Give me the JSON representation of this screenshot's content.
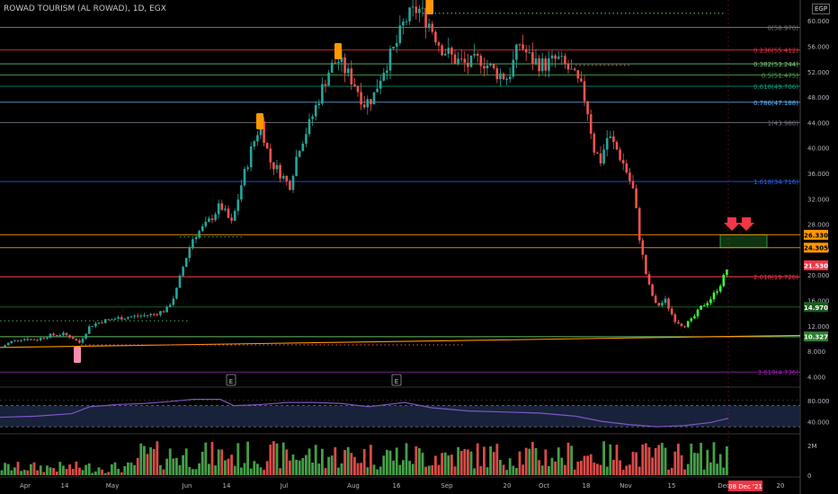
{
  "header": {
    "title": "ROWAD TOURISM (AL ROWAD), 1D, EGX",
    "currency": "EGP"
  },
  "chart_data": {
    "type": "candlestick",
    "title": "ROWAD TOURISM (AL ROWAD), 1D, EGX",
    "y_axis": {
      "ticks": [
        "60.000",
        "56.000",
        "52.000",
        "48.000",
        "44.000",
        "40.000",
        "36.000",
        "32.000",
        "28.000",
        "24.000",
        "20.000",
        "16.000",
        "12.000",
        "8.000",
        "4.000"
      ],
      "tick_values": [
        60,
        56,
        52,
        48,
        44,
        40,
        36,
        32,
        28,
        24,
        20,
        16,
        12,
        8,
        4
      ],
      "range": [
        2.5,
        63
      ]
    },
    "x_axis": {
      "labels": [
        "Apr",
        "14",
        "May",
        "Jun",
        "14",
        "Jul",
        "Aug",
        "16",
        "Sep",
        "20",
        "Oct",
        "18",
        "Nov",
        "15",
        "Dec",
        "20"
      ],
      "date_label": "08 Dec '21"
    },
    "close_path": [
      [
        0,
        8.5
      ],
      [
        12,
        9.5
      ],
      [
        25,
        10.0
      ],
      [
        40,
        9.8
      ],
      [
        55,
        10.5
      ],
      [
        70,
        10.7
      ],
      [
        80,
        10.2
      ],
      [
        88,
        9.3
      ],
      [
        100,
        12.0
      ],
      [
        115,
        12.8
      ],
      [
        130,
        13.2
      ],
      [
        150,
        13.5
      ],
      [
        170,
        13.8
      ],
      [
        185,
        14.5
      ],
      [
        195,
        17.0
      ],
      [
        205,
        22.0
      ],
      [
        215,
        26.0
      ],
      [
        230,
        28.0
      ],
      [
        245,
        31.0
      ],
      [
        258,
        28.0
      ],
      [
        268,
        34.0
      ],
      [
        280,
        40.0
      ],
      [
        290,
        44.0
      ],
      [
        300,
        38.0
      ],
      [
        312,
        36.0
      ],
      [
        322,
        34.0
      ],
      [
        332,
        40.0
      ],
      [
        345,
        44.0
      ],
      [
        355,
        48.0
      ],
      [
        365,
        52.0
      ],
      [
        375,
        54.0
      ],
      [
        385,
        52.0
      ],
      [
        395,
        50.0
      ],
      [
        405,
        47.0
      ],
      [
        415,
        48.0
      ],
      [
        425,
        52.0
      ],
      [
        440,
        56.0
      ],
      [
        450,
        60.0
      ],
      [
        465,
        62.0
      ],
      [
        478,
        59.5
      ],
      [
        490,
        56.0
      ],
      [
        505,
        54.0
      ],
      [
        520,
        53.0
      ],
      [
        535,
        54.0
      ],
      [
        550,
        52.0
      ],
      [
        565,
        51.0
      ],
      [
        578,
        56.5
      ],
      [
        590,
        54.0
      ],
      [
        605,
        53.0
      ],
      [
        620,
        54.0
      ],
      [
        635,
        52.0
      ],
      [
        648,
        49.0
      ],
      [
        655,
        45.0
      ],
      [
        660,
        40.0
      ],
      [
        668,
        38.0
      ],
      [
        676,
        42.0
      ],
      [
        685,
        40.0
      ],
      [
        695,
        37.0
      ],
      [
        705,
        33.0
      ],
      [
        712,
        25.0
      ],
      [
        720,
        19.0
      ],
      [
        730,
        15.0
      ],
      [
        740,
        16.0
      ],
      [
        750,
        13.0
      ],
      [
        760,
        12.0
      ],
      [
        770,
        13.0
      ],
      [
        780,
        15.0
      ],
      [
        792,
        16.5
      ],
      [
        803,
        19.0
      ],
      [
        810,
        21.53
      ]
    ],
    "fib_levels": [
      {
        "label": "0(58.970)",
        "value": 58.97,
        "color": "#787b86"
      },
      {
        "label": "0.236(55.412)",
        "value": 55.412,
        "color": "#f23645"
      },
      {
        "label": "0.382(53.244)",
        "value": 53.244,
        "color": "#81c784"
      },
      {
        "label": "0.5(51.475)",
        "value": 51.475,
        "color": "#4caf50"
      },
      {
        "label": "0.618(49.706)",
        "value": 49.706,
        "color": "#089981"
      },
      {
        "label": "0.786(47.188)",
        "value": 47.188,
        "color": "#64b5f6"
      },
      {
        "label": "1(43.980)",
        "value": 43.98,
        "color": "#787b86"
      },
      {
        "label": "1.618(34.716)",
        "value": 34.716,
        "color": "#2962ff"
      },
      {
        "label": "2.618(19.726)",
        "value": 19.726,
        "color": "#f23645"
      },
      {
        "label": "3.618(4.736)",
        "value": 4.736,
        "color": "#9c27b0"
      }
    ],
    "price_badges": [
      {
        "label": "26.330",
        "value": 26.33,
        "bg": "#ff9800",
        "fg": "#000000"
      },
      {
        "label": "24.305",
        "value": 24.305,
        "bg": "#ff9800",
        "fg": "#000000"
      },
      {
        "label": "21.530",
        "value": 21.53,
        "bg": "#f23645",
        "fg": "#ffffff"
      },
      {
        "label": "14.970",
        "value": 14.97,
        "bg": "#1b5e20",
        "fg": "#ffffff"
      },
      {
        "label": "10.327",
        "value": 10.327,
        "bg": "#2e7d32",
        "fg": "#ffffff"
      }
    ],
    "horizontal_lines": [
      {
        "value": 26.33,
        "color": "#ff9800"
      },
      {
        "value": 24.305,
        "color": "#ff9800"
      },
      {
        "value": 19.726,
        "color": "#f23645"
      }
    ],
    "rsi": {
      "ticks": [
        "80.000",
        "40.000"
      ],
      "tick_values": [
        80,
        40
      ],
      "range": [
        20,
        100
      ],
      "band": [
        30,
        70
      ],
      "path": [
        [
          0,
          48
        ],
        [
          40,
          50
        ],
        [
          80,
          55
        ],
        [
          100,
          68
        ],
        [
          130,
          72
        ],
        [
          160,
          74
        ],
        [
          190,
          78
        ],
        [
          215,
          82
        ],
        [
          245,
          82
        ],
        [
          260,
          70
        ],
        [
          290,
          72
        ],
        [
          320,
          76
        ],
        [
          350,
          76
        ],
        [
          380,
          74
        ],
        [
          410,
          68
        ],
        [
          450,
          76
        ],
        [
          480,
          66
        ],
        [
          520,
          60
        ],
        [
          560,
          58
        ],
        [
          600,
          56
        ],
        [
          640,
          50
        ],
        [
          670,
          40
        ],
        [
          700,
          34
        ],
        [
          730,
          30
        ],
        [
          760,
          32
        ],
        [
          790,
          38
        ],
        [
          810,
          46
        ]
      ]
    },
    "volume": {
      "ticks": [
        "2M",
        "0"
      ],
      "tick_values": [
        2000000,
        0
      ],
      "range": [
        0,
        2600000
      ]
    },
    "event_markers": [
      "E",
      "E"
    ],
    "arrows": [
      "down",
      "down"
    ]
  },
  "colors": {
    "up": "#26a69a",
    "down": "#ef5350",
    "bright_up": "#3cff3c",
    "bg": "#000000"
  }
}
